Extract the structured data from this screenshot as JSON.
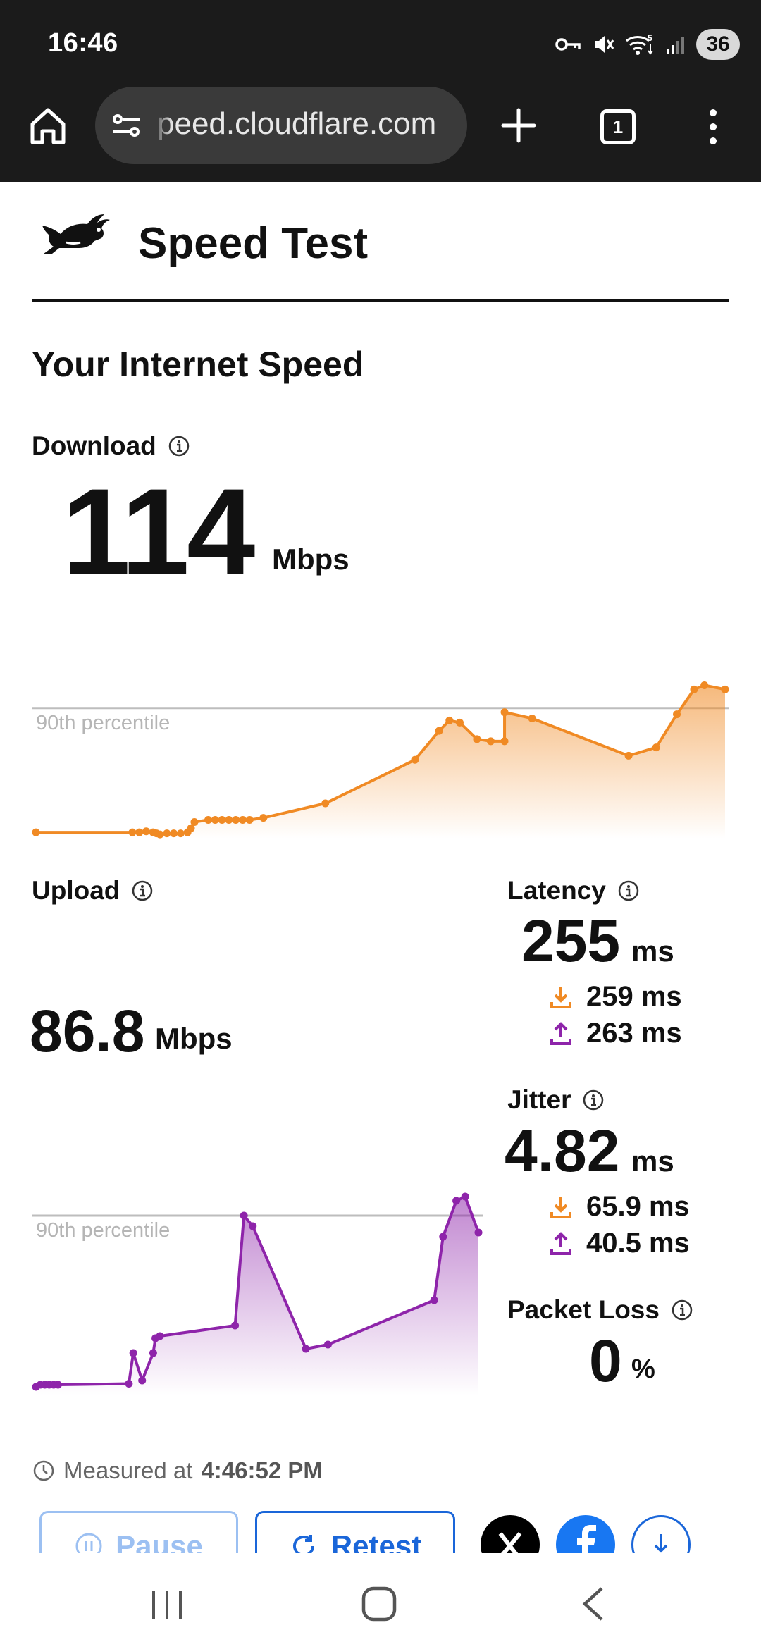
{
  "status_bar": {
    "time": "16:46",
    "icons": [
      "vpn-key-icon",
      "mute-icon",
      "wifi-icon",
      "signal-icon"
    ],
    "battery": "36"
  },
  "browser": {
    "url": "peed.cloudflare.com",
    "tab_count": "1",
    "icons": [
      "home-icon",
      "site-settings-icon",
      "plus-icon",
      "tab-switcher-icon",
      "more-vert-icon"
    ]
  },
  "header": {
    "title": "Speed Test",
    "logo_icon": "rabbit-icon"
  },
  "main": {
    "section_title": "Your Internet Speed",
    "download": {
      "label": "Download",
      "value": "114",
      "unit": "Mbps",
      "percentile_label": "90th percentile",
      "color": "#f08a24"
    },
    "upload": {
      "label": "Upload",
      "value": "86.8",
      "unit": "Mbps",
      "percentile_label": "90th percentile",
      "color": "#8e24aa"
    },
    "latency": {
      "label": "Latency",
      "value": "255",
      "unit": "ms",
      "download": "259 ms",
      "upload": "263 ms"
    },
    "jitter": {
      "label": "Jitter",
      "value": "4.82",
      "unit": "ms",
      "download": "65.9 ms",
      "upload": "40.5 ms"
    },
    "packet_loss": {
      "label": "Packet Loss",
      "value": "0",
      "unit": "%"
    },
    "measured": {
      "prefix": "Measured at",
      "time": "4:46:52 PM"
    }
  },
  "actions": {
    "pause": "Pause",
    "retest": "Retest",
    "share_icons": [
      "x-logo-icon",
      "facebook-icon",
      "download-icon"
    ]
  },
  "nav": {
    "icons": [
      "recent-apps-icon",
      "home-nav-icon",
      "back-icon"
    ]
  },
  "colors": {
    "download": "#f08a24",
    "upload": "#8e24aa",
    "accent_blue": "#1a66d9",
    "chrome_bg": "#1b1b1b"
  },
  "chart_data": [
    {
      "type": "area",
      "name": "Download",
      "x": [
        0,
        0.14,
        0.15,
        0.16,
        0.17,
        0.175,
        0.18,
        0.19,
        0.2,
        0.21,
        0.22,
        0.225,
        0.23,
        0.25,
        0.26,
        0.27,
        0.28,
        0.29,
        0.3,
        0.31,
        0.33,
        0.42,
        0.55,
        0.585,
        0.6,
        0.615,
        0.64,
        0.66,
        0.68,
        0.68,
        0.72,
        0.86,
        0.9,
        0.93,
        0.955,
        0.97,
        1.0
      ],
      "values": [
        0.03,
        0.03,
        0.03,
        0.035,
        0.03,
        0.025,
        0.02,
        0.025,
        0.025,
        0.025,
        0.03,
        0.05,
        0.08,
        0.09,
        0.09,
        0.09,
        0.09,
        0.09,
        0.09,
        0.09,
        0.1,
        0.17,
        0.38,
        0.52,
        0.57,
        0.56,
        0.48,
        0.47,
        0.47,
        0.61,
        0.58,
        0.4,
        0.44,
        0.6,
        0.72,
        0.74,
        0.72
      ],
      "reference_lines": [
        {
          "label": "90th percentile",
          "y": 0.63
        }
      ],
      "color": "#f08a24"
    },
    {
      "type": "area",
      "name": "Upload",
      "x": [
        0,
        0.01,
        0.02,
        0.03,
        0.04,
        0.05,
        0.21,
        0.22,
        0.24,
        0.265,
        0.27,
        0.28,
        0.45,
        0.47,
        0.49,
        0.61,
        0.66,
        0.9,
        0.92,
        0.95,
        0.97,
        1.0
      ],
      "values": [
        0.04,
        0.05,
        0.05,
        0.05,
        0.05,
        0.05,
        0.055,
        0.2,
        0.07,
        0.2,
        0.27,
        0.28,
        0.33,
        0.85,
        0.8,
        0.22,
        0.24,
        0.45,
        0.75,
        0.92,
        0.94,
        0.77
      ],
      "reference_lines": [
        {
          "label": "90th percentile",
          "y": 0.85
        }
      ],
      "color": "#8e24aa"
    }
  ]
}
